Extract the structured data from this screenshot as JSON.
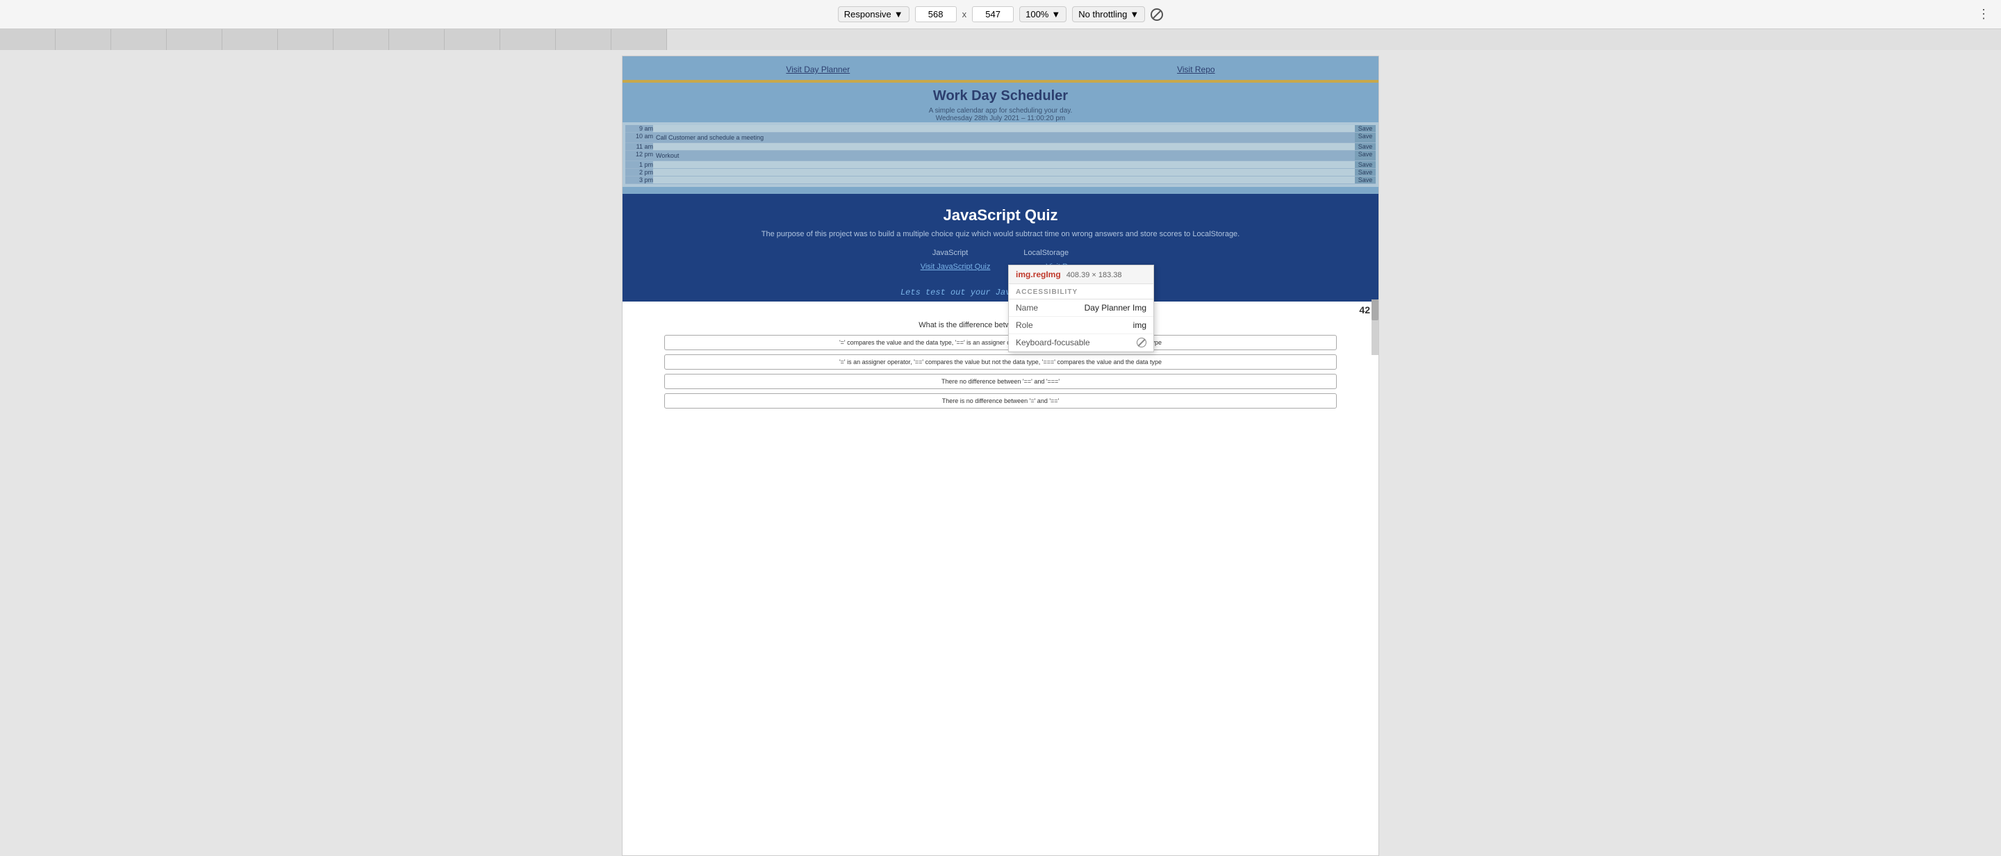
{
  "toolbar": {
    "responsive_label": "Responsive",
    "responsive_arrow": "▼",
    "width_value": "568",
    "separator": "x",
    "height_value": "547",
    "zoom_label": "100%",
    "zoom_arrow": "▼",
    "throttle_label": "No throttling",
    "throttle_arrow": "▼",
    "more_icon": "⋮"
  },
  "tabbar": {
    "tabs": [
      {
        "label": ""
      },
      {
        "label": ""
      },
      {
        "label": ""
      },
      {
        "label": ""
      },
      {
        "label": ""
      },
      {
        "label": ""
      },
      {
        "label": ""
      },
      {
        "label": ""
      },
      {
        "label": ""
      },
      {
        "label": ""
      },
      {
        "label": ""
      },
      {
        "label": ""
      },
      {
        "label": ""
      }
    ]
  },
  "wds": {
    "nav": {
      "link1": "Visit Day Planner",
      "link2": "Visit Repo"
    },
    "title": "Work Day Scheduler",
    "subtitle1": "A simple calendar app for scheduling your day.",
    "subtitle2": "Wednesday 28th July 2021 – 11:00:20 pm",
    "rows": [
      {
        "time": "9 am",
        "content": "",
        "btn": "Save"
      },
      {
        "time": "10 am",
        "content": "Call Customer and schedule a meeting",
        "btn": "Save"
      },
      {
        "time": "11 am",
        "content": "",
        "btn": "Save"
      },
      {
        "time": "12 pm",
        "content": "Workout",
        "btn": "Save"
      },
      {
        "time": "1 pm",
        "content": "",
        "btn": "Save"
      },
      {
        "time": "2 pm",
        "content": "",
        "btn": "Save"
      },
      {
        "time": "3 pm",
        "content": "",
        "btn": "Save"
      }
    ]
  },
  "tooltip": {
    "tag": "img.regImg",
    "dimensions": "408.39 × 183.38",
    "section": "ACCESSIBILITY",
    "rows": [
      {
        "label": "Name",
        "value": "Day Planner Img"
      },
      {
        "label": "Role",
        "value": "img"
      },
      {
        "label": "Keyboard-focusable",
        "value": "no-icon"
      }
    ]
  },
  "quiz": {
    "title": "ript Quiz",
    "title_prefix": "Ja",
    "full_title": "JavaScript Quiz",
    "desc": "The purpose of this project was to build a multiple choice quiz which would subtract time on wrong answers and store scores to LocalStorage.",
    "tags": [
      "JavaScript",
      "LocalStorage"
    ],
    "links": [
      "Visit JavaScript Quiz",
      "Visit Repo"
    ],
    "banner": "Lets test out your JavaScript knowledge!",
    "question_number": "42",
    "question": "What is the difference between '=', '==' and '==='",
    "options": [
      "'=' compares the value and the data type, '==' is an assigner operator, '===' compares the value but not the data type",
      "'=' is an assigner operator, '==' compares the value but not the data type, '===' compares the value and the data type",
      "There no difference between '==' and '==='",
      "There is no difference between '=' and '=='"
    ]
  }
}
